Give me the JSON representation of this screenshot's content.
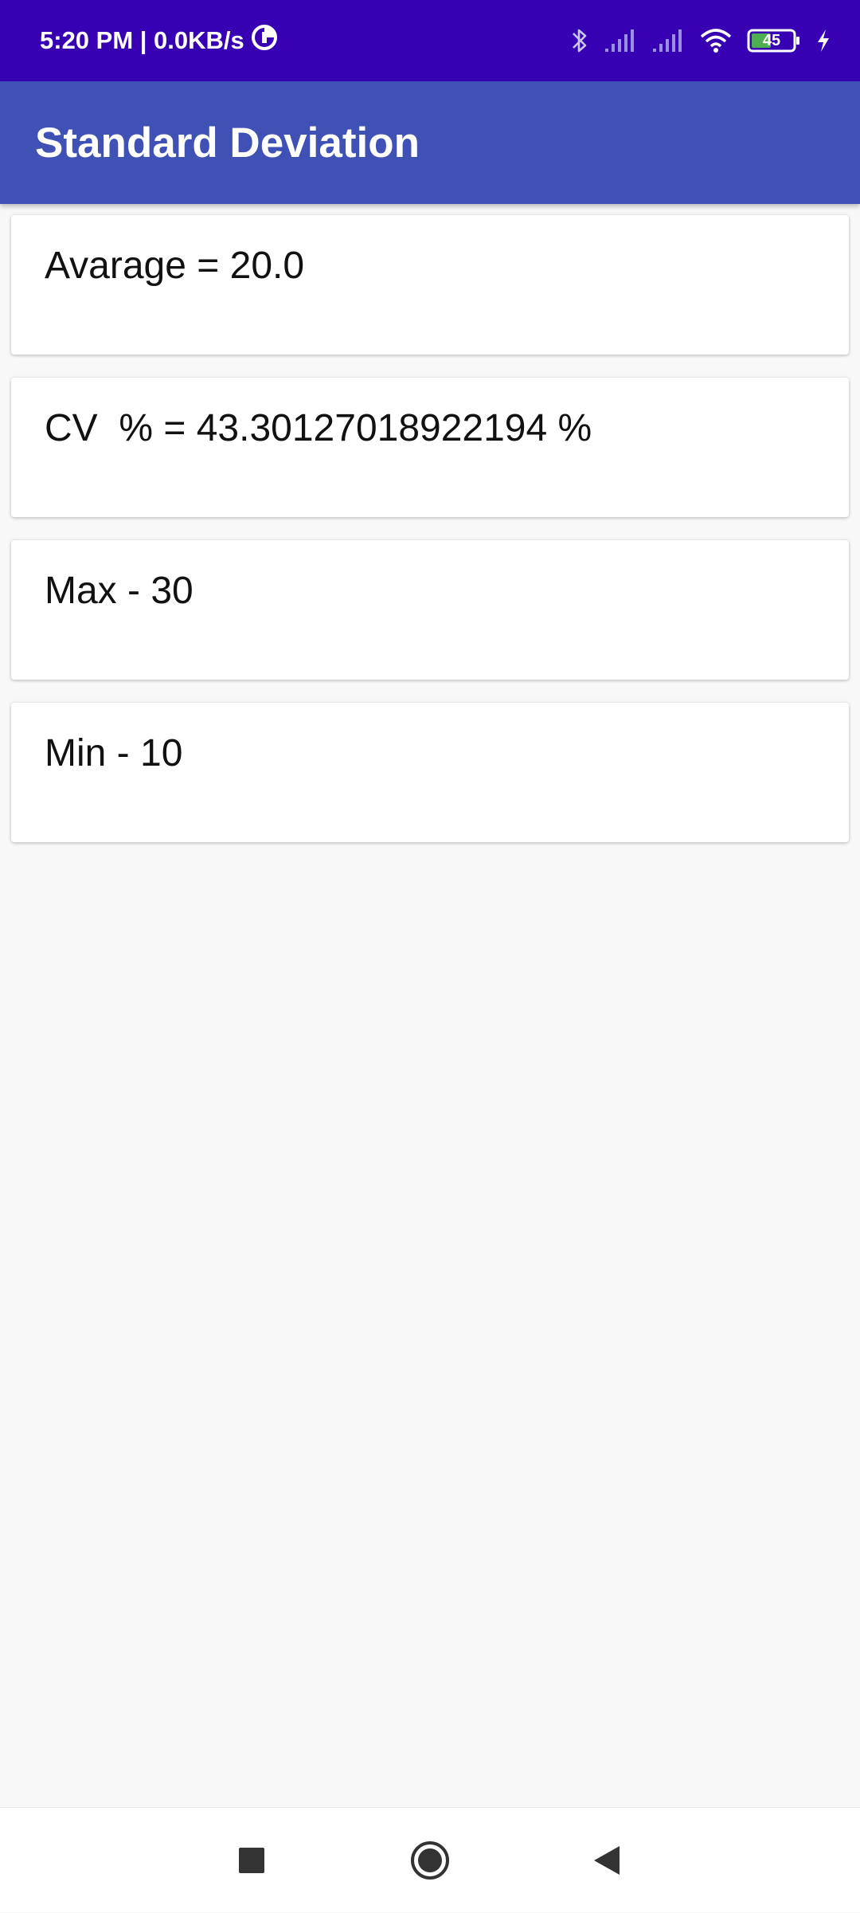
{
  "status_bar": {
    "time_speed": "5:20 PM | 0.0KB/s",
    "battery_level": "45",
    "icons": [
      "data-saver-icon",
      "bluetooth-icon",
      "signal-icon",
      "signal-icon",
      "wifi-icon",
      "battery-icon",
      "charging-icon"
    ]
  },
  "app_bar": {
    "title": "Standard Deviation"
  },
  "results": [
    {
      "text": "Avarage = 20.0"
    },
    {
      "text": "CV  % = 43.30127018922194 %"
    },
    {
      "text": "Max - 30"
    },
    {
      "text": "Min - 10"
    }
  ],
  "nav_bar": {
    "icons": [
      "recents-square-icon",
      "home-circle-icon",
      "back-triangle-icon"
    ]
  },
  "colors": {
    "status_bar": "#3700b3",
    "app_bar": "#3f51b5",
    "background": "#f8f8f8",
    "card": "#ffffff"
  }
}
